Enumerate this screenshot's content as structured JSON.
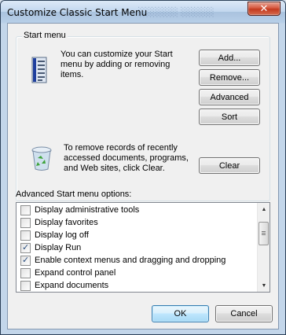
{
  "window": {
    "title": "Customize Classic Start Menu",
    "close_glyph": "✕",
    "icon_close": "close-icon"
  },
  "start_menu_group": {
    "label": "Start menu",
    "customize_text": "You can customize your Start\nmenu by adding or removing\nitems.",
    "clear_text": "To remove records of recently\naccessed documents, programs,\nand Web sites, click Clear.",
    "buttons": {
      "add": "Add...",
      "remove": "Remove...",
      "advanced": "Advanced",
      "sort": "Sort",
      "clear": "Clear"
    },
    "icons": [
      "start-menu-icon",
      "recycle-bin-icon"
    ]
  },
  "advanced_options": {
    "label": "Advanced Start menu options:",
    "items": [
      {
        "label": "Display administrative tools",
        "checked": false
      },
      {
        "label": "Display favorites",
        "checked": false
      },
      {
        "label": "Display log off",
        "checked": false
      },
      {
        "label": "Display Run",
        "checked": true
      },
      {
        "label": "Enable context menus and dragging and dropping",
        "checked": true
      },
      {
        "label": "Expand control panel",
        "checked": false
      },
      {
        "label": "Expand documents",
        "checked": false
      }
    ]
  },
  "dialog_buttons": {
    "ok": "OK",
    "cancel": "Cancel"
  },
  "colors": {
    "close_button": "#c33a1f",
    "default_button_border": "#3c7fb1",
    "check_color": "#2a4e7f"
  }
}
